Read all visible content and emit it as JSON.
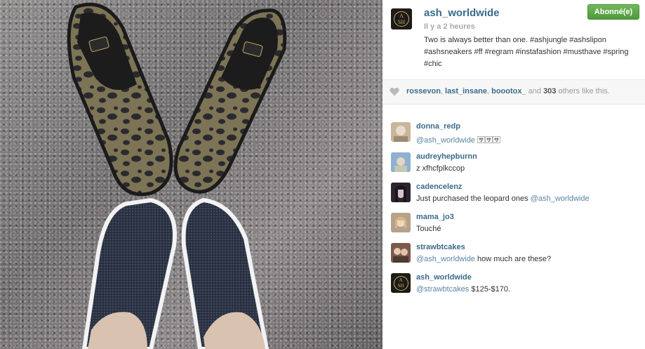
{
  "post": {
    "owner": "ash_worldwide",
    "time": "Il y a 2 heures",
    "caption": "Two is always better than one. #ashjungle #ashslipon #ashsneakers #ff #regram #instafashion #musthave #spring #chic",
    "follow_label": "Abonné(e)",
    "avatar_monogram_top": "A",
    "avatar_monogram_bottom": "SH"
  },
  "likes": {
    "users": [
      "rossevon",
      "last_insane",
      "boootox_"
    ],
    "sep1": ", ",
    "sep2": ", ",
    "and": " and ",
    "count": "303",
    "suffix": " others like this."
  },
  "comments": [
    {
      "user": "donna_redp",
      "mention": "@ash_worldwide",
      "text": " 🈂🈂🈂",
      "avatar_color": "#c9b59c"
    },
    {
      "user": "audreyhepburnn",
      "mention": "",
      "text": "z xfhcfplkccop",
      "avatar_color": "#6d86a3"
    },
    {
      "user": "cadencelenz",
      "mention": "",
      "text": "Just purchased the leopard ones ",
      "mention_after": "@ash_worldwide",
      "avatar_color": "#3b3340"
    },
    {
      "user": "mama_jo3",
      "mention": "",
      "text": "Touché",
      "avatar_color": "#c7a98d"
    },
    {
      "user": "strawbtcakes",
      "mention": "@ash_worldwide",
      "text": " how much are these?",
      "avatar_color": "#8e6b5a"
    },
    {
      "user": "ash_worldwide",
      "mention": "@strawbtcakes",
      "text": " $125-$170.",
      "avatar_color": "#1d1b16"
    }
  ],
  "colors": {
    "link": "#3a6b8a",
    "follow_green": "#5aa544"
  },
  "icons": {
    "heart": "heart-icon"
  }
}
